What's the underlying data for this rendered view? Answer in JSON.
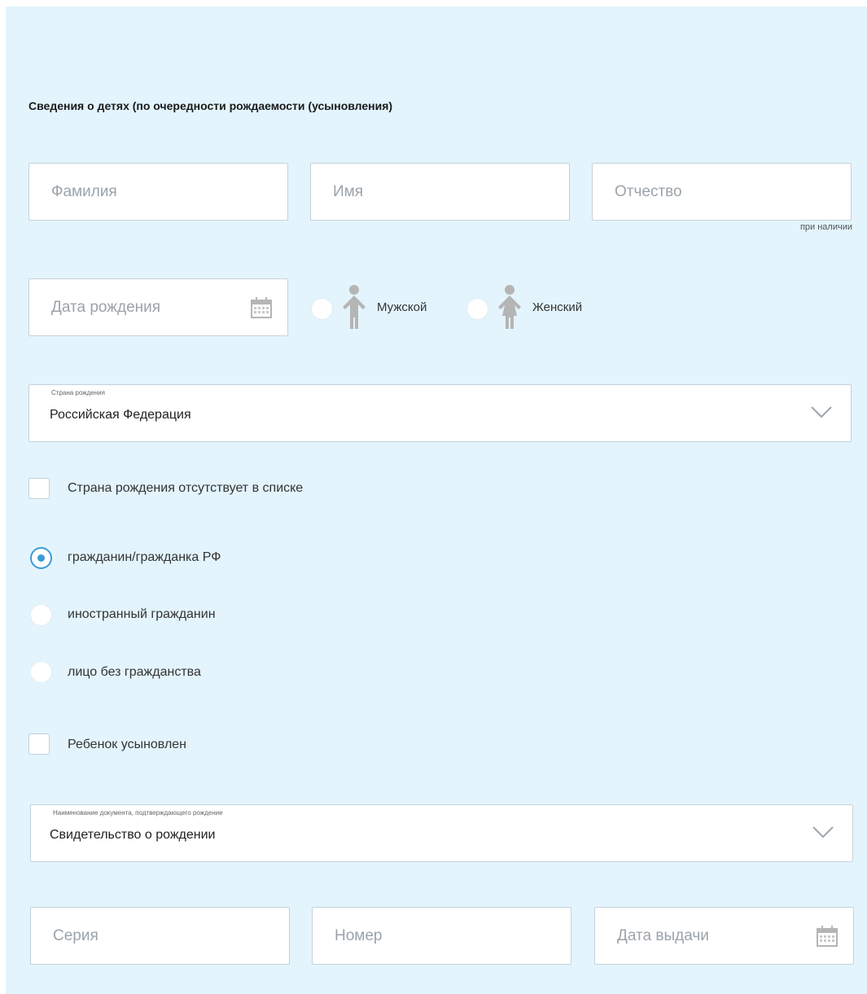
{
  "section": {
    "title": "Сведения о детях (по очередности рождаемости (усыновления)"
  },
  "name_fields": {
    "last_name_placeholder": "Фамилия",
    "first_name_placeholder": "Имя",
    "patronymic_placeholder": "Отчество",
    "patronymic_hint": "при наличии"
  },
  "birth": {
    "date_placeholder": "Дата рождения",
    "calendar_icon": "calendar-icon",
    "gender_options": [
      {
        "label": "Мужской",
        "icon": "male-person-icon",
        "selected": false
      },
      {
        "label": "Женский",
        "icon": "female-person-icon",
        "selected": false
      }
    ]
  },
  "birth_country": {
    "label": "Страна рождения",
    "value": "Российская Федерация",
    "not_in_list_label": "Страна рождения отсутствует в списке",
    "not_in_list_checked": false
  },
  "citizenship": {
    "options": [
      {
        "label": "гражданин/гражданка РФ",
        "selected": true
      },
      {
        "label": "иностранный гражданин",
        "selected": false
      },
      {
        "label": "лицо без гражданства",
        "selected": false
      }
    ]
  },
  "adopted": {
    "label": "Ребенок усыновлен",
    "checked": false
  },
  "document": {
    "label": "Наименование документа, подтверждающего рождение",
    "value": "Свидетельство о рождении",
    "series_placeholder": "Серия",
    "number_placeholder": "Номер",
    "issue_date_placeholder": "Дата выдачи"
  },
  "colors": {
    "panel_background": "#e3f4fd",
    "field_border": "#c5d1da",
    "accent": "#3a9ad9",
    "placeholder": "#9ba3aa",
    "icon_gray": "#b5b5b5"
  }
}
